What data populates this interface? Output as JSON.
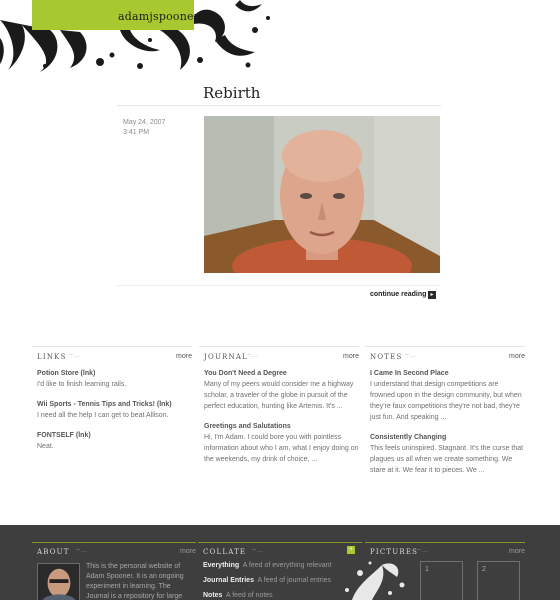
{
  "header": {
    "site_name": "adamjspooner",
    "accent": "#a7c82f"
  },
  "post": {
    "title": "Rebirth",
    "date": "May 24, 2007",
    "time": "3:41 PM",
    "continue_label": "continue reading"
  },
  "columns": [
    {
      "title": "LINKS",
      "more": "more",
      "items": [
        {
          "title": "Potion Store (lnk)",
          "body": "I'd like to finish learning rails."
        },
        {
          "title": "Wii Sports - Tennis Tips and Tricks! (lnk)",
          "body": "I need all the help I can get to beat Allison."
        },
        {
          "title": "FONTSELF (lnk)",
          "body": "Neat."
        }
      ]
    },
    {
      "title": "JOURNAL",
      "more": "more",
      "items": [
        {
          "title": "You Don't Need a Degree",
          "body": "Many of my peers would consider me a highway scholar, a traveler of the globe in pursuit of the perfect education, hunting like Artemis. It's ..."
        },
        {
          "title": "Greetings and Salutations",
          "body": "Hi, I'm Adam. I could bore you with pointless information about who I am, what I enjoy doing on the weekends, my drink of choice, ..."
        }
      ]
    },
    {
      "title": "NOTES",
      "more": "more",
      "items": [
        {
          "title": "I Came In Second Place",
          "body": "I understand that design competitions are frowned upon in the design community, but when they're faux competitions they're not bad, they're just fun. And speaking ..."
        },
        {
          "title": "Consistently Changing",
          "body": "This feels uninspired. Stagnant. It's the curse that plagues us all when we create something. We stare at it. We fear it to pieces. We ..."
        }
      ]
    }
  ],
  "footer": {
    "about": {
      "title": "ABOUT",
      "more": "more",
      "text": "This is the personal website of Adam Spooner. It is an ongoing experiment in learning. The Journal is a repository for large"
    },
    "collate": {
      "title": "COLLATE",
      "plus": "+",
      "rows": [
        {
          "label": "Everything",
          "desc": "A feed of everything relevant"
        },
        {
          "label": "Journal Entries",
          "desc": "A feed of journal entries"
        },
        {
          "label": "Notes",
          "desc": "A feed of notes"
        }
      ]
    },
    "pictures": {
      "title": "PICTURES",
      "more": "more",
      "thumbs": [
        "1",
        "2"
      ]
    }
  }
}
